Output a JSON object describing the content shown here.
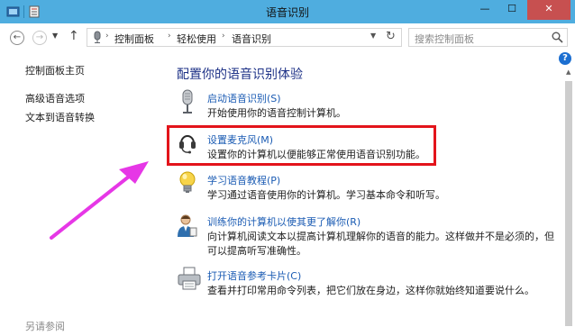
{
  "window": {
    "title": "语音识别",
    "minimize": "—",
    "maximize": "☐",
    "close": "✕"
  },
  "nav": {
    "back": "←",
    "forward": "→",
    "recent": "▼",
    "up": "↑"
  },
  "address": {
    "crumbs": [
      "控制面板",
      "轻松使用",
      "语音识别"
    ],
    "separator": "›",
    "dropdown": "▼",
    "refresh": "↻"
  },
  "search": {
    "placeholder": "搜索控制面板"
  },
  "sidebar": {
    "items": [
      {
        "label": "控制面板主页"
      },
      {
        "label": "高级语音选项"
      },
      {
        "label": "文本到语音转换"
      }
    ],
    "see_also": "另请参阅"
  },
  "help": "?",
  "main": {
    "heading": "配置你的语音识别体验",
    "tasks": [
      {
        "icon": "microphone-icon",
        "link": "启动语音识别(S)",
        "desc": "开始使用你的语音控制计算机。"
      },
      {
        "icon": "headset-icon",
        "link": "设置麦克风(M)",
        "desc": "设置你的计算机以便能够正常使用语音识别功能。"
      },
      {
        "icon": "lightbulb-icon",
        "link": "学习语音教程(P)",
        "desc": "学习通过语音使用你的计算机。学习基本命令和听写。"
      },
      {
        "icon": "user-speaking-icon",
        "link": "训练你的计算机以使其更了解你(R)",
        "desc": "向计算机阅读文本以提高计算机理解你的语音的能力。这样做并不是必须的，但可以提高听写准确性。"
      },
      {
        "icon": "printer-icon",
        "link": "打开语音参考卡片(C)",
        "desc": "查看并打印常用命令列表，把它们放在身边，这样你就始终知道要说什么。"
      }
    ]
  },
  "colors": {
    "titlebar": "#4faddf",
    "link": "#1a5bb3",
    "heading": "#1e3287",
    "highlight": "#e3141b",
    "arrow": "#e637e6"
  }
}
